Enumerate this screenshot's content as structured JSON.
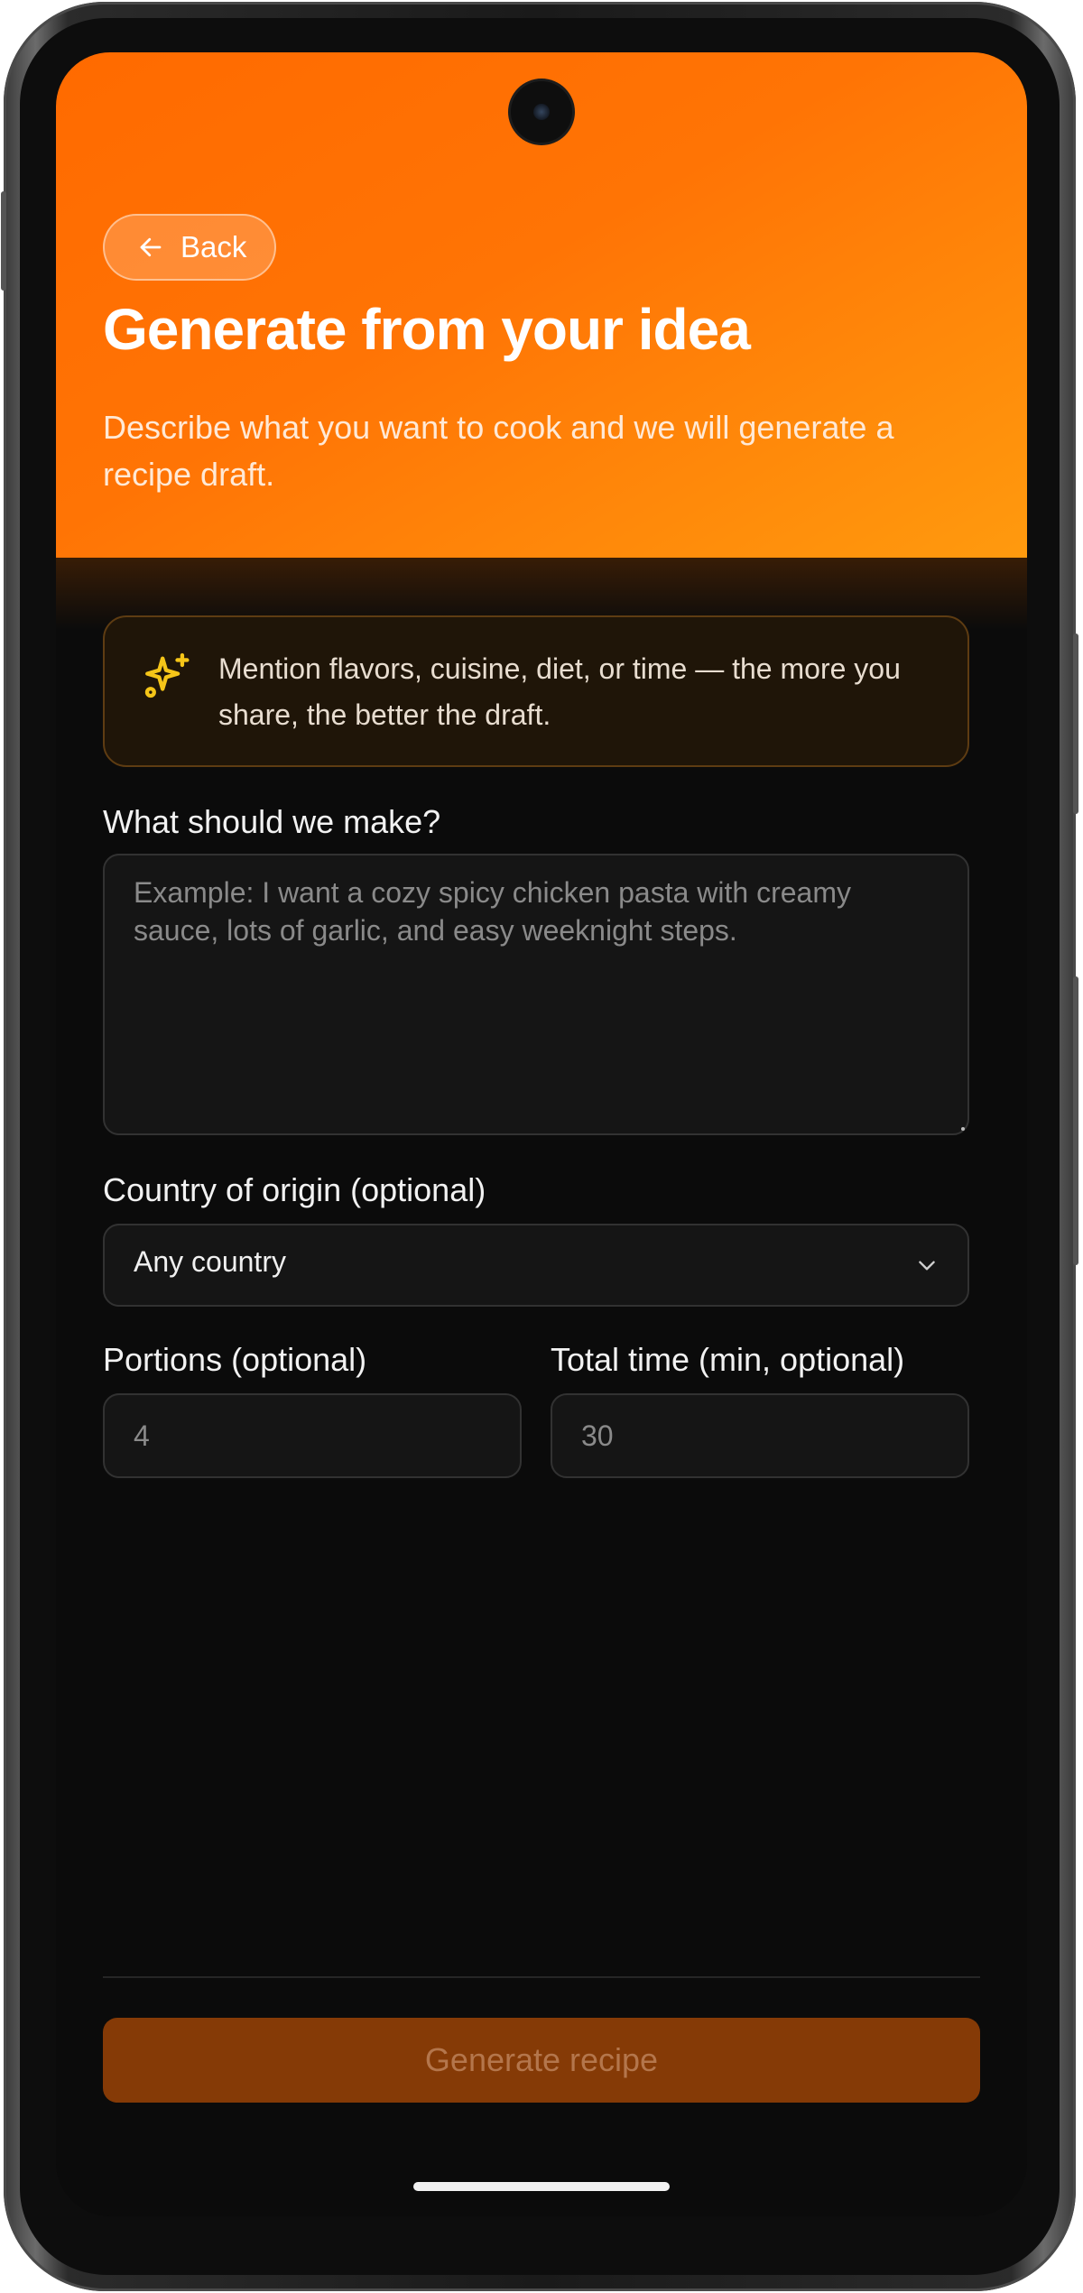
{
  "header": {
    "back_label": "Back",
    "title": "Generate from your idea",
    "subtitle": "Describe what you want to cook and we will generate a recipe draft."
  },
  "tip": {
    "icon": "sparkles-icon",
    "text": "Mention flavors, cuisine, diet, or time — the more you share, the better the draft."
  },
  "form": {
    "prompt": {
      "label": "What should we make?",
      "value": "",
      "placeholder": "Example: I want a cozy spicy chicken pasta with creamy sauce, lots of garlic, and easy weeknight steps."
    },
    "country": {
      "label": "Country of origin (optional)",
      "selected": "Any country"
    },
    "portions": {
      "label": "Portions (optional)",
      "value": "",
      "placeholder": "4"
    },
    "total_time": {
      "label": "Total time (min, optional)",
      "value": "",
      "placeholder": "30"
    }
  },
  "actions": {
    "generate_label": "Generate recipe",
    "generate_enabled": false
  },
  "colors": {
    "accent": "#ff6a00",
    "accent_disabled": "#853a06",
    "tip_icon": "#f5c518"
  }
}
